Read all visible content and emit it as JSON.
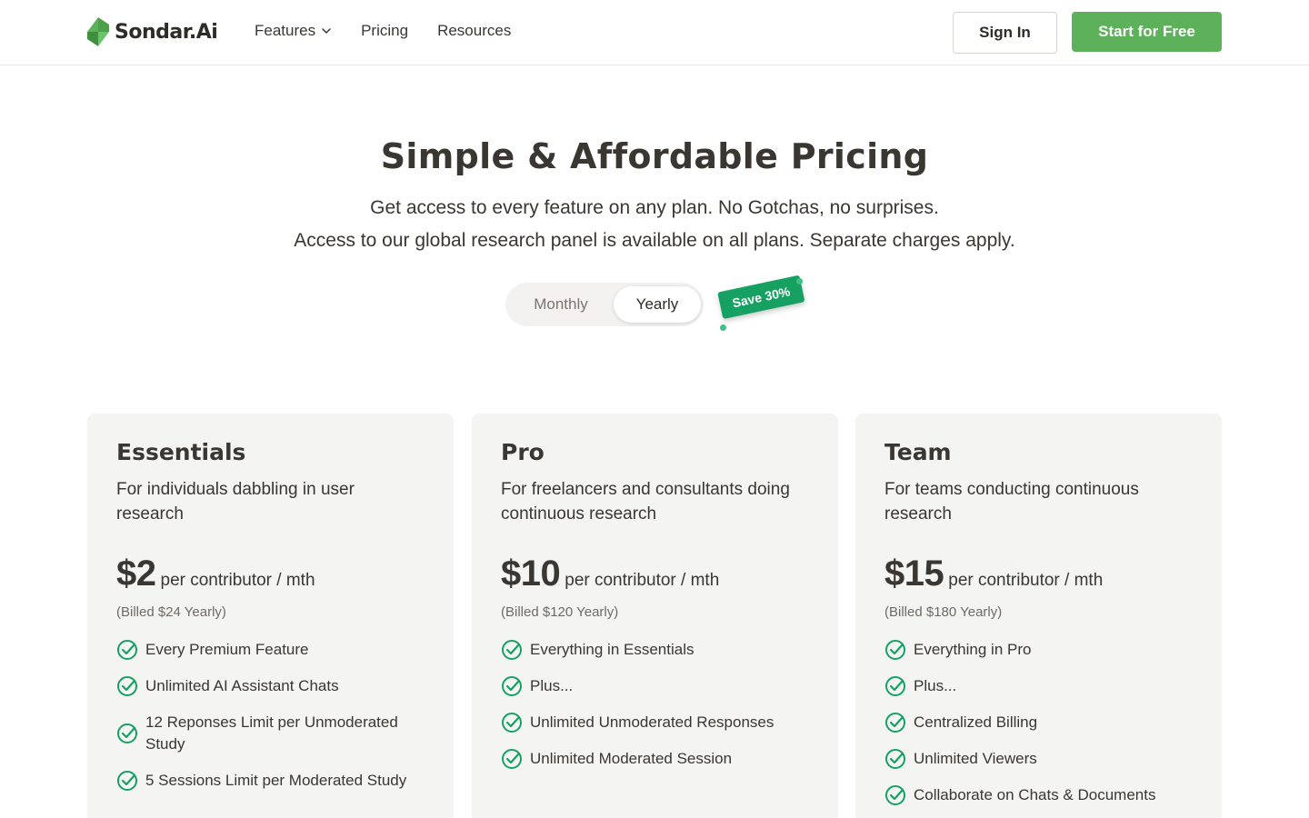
{
  "header": {
    "logo_text": "Sondar.Ai",
    "nav": [
      {
        "label": "Features",
        "has_dropdown": true
      },
      {
        "label": "Pricing",
        "has_dropdown": false
      },
      {
        "label": "Resources",
        "has_dropdown": false
      }
    ],
    "sign_in_label": "Sign In",
    "start_label": "Start for Free"
  },
  "hero": {
    "title": "Simple & Affordable Pricing",
    "subtitle_1": "Get access to every feature on any plan. No Gotchas, no surprises.",
    "subtitle_2": "Access to our global research panel is available on all plans. Separate charges apply."
  },
  "billing_toggle": {
    "monthly_label": "Monthly",
    "yearly_label": "Yearly",
    "selected": "Yearly",
    "save_badge": "Save 30%"
  },
  "colors": {
    "brand_green": "#5cb15a",
    "badge_green": "#16a163",
    "check_green": "#16a163",
    "text_dark": "#3a3632",
    "card_bg": "#f4f4f2"
  },
  "plans": [
    {
      "name": "Essentials",
      "description": "For individuals dabbling in user research",
      "price": "$2",
      "per": "per contributor / mth",
      "billed": "(Billed $24 Yearly)",
      "features": [
        "Every Premium Feature",
        "Unlimited AI Assistant Chats",
        "12 Reponses Limit per Unmoderated Study",
        "5 Sessions Limit per Moderated Study"
      ]
    },
    {
      "name": "Pro",
      "description": "For freelancers and consultants doing continuous research",
      "price": "$10",
      "per": "per contributor / mth",
      "billed": "(Billed $120 Yearly)",
      "features": [
        "Everything in Essentials",
        "Plus...",
        "Unlimited Unmoderated Responses",
        "Unlimited Moderated Session"
      ]
    },
    {
      "name": "Team",
      "description": "For teams conducting continuous research",
      "price": "$15",
      "per": "per contributor / mth",
      "billed": "(Billed $180 Yearly)",
      "features": [
        "Everything in Pro",
        "Plus...",
        "Centralized Billing",
        "Unlimited Viewers",
        "Collaborate on Chats & Documents"
      ]
    }
  ]
}
